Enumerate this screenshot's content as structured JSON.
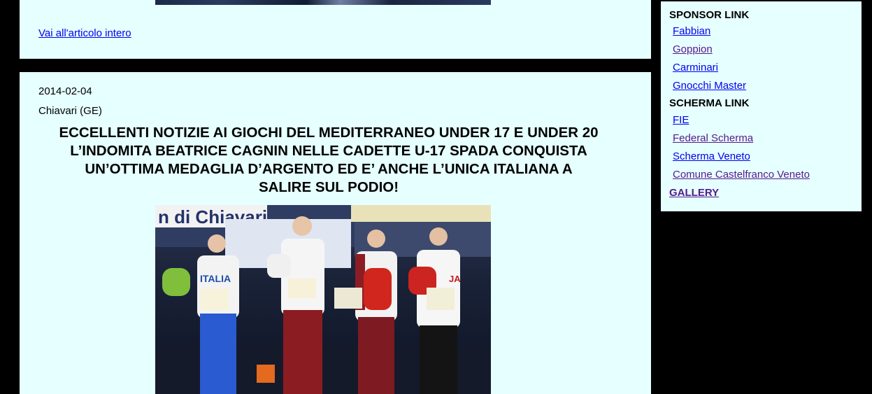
{
  "top_article": {
    "read_more": "Vai all'articolo intero"
  },
  "article": {
    "date": "2014-02-04",
    "place": "Chiavari (GE)",
    "headline_lines": [
      "ECCELLENTI NOTIZIE AI GIOCHI DEL MEDITERRANEO UNDER 17 E UNDER 20",
      "L’INDOMITA BEATRICE CAGNIN NELLE CADETTE U-17 SPADA CONQUISTA",
      "UN’OTTIMA MEDAGLIA D’ARGENTO ED E’ ANCHE L’UNICA ITALIANA A",
      "SALIRE SUL PODIO!"
    ],
    "photo": {
      "banner_text": "n di Chiavari",
      "jacket_text_1": "ITALIA",
      "jacket_text_2": "JA"
    }
  },
  "sidebar": {
    "sponsor_heading": "SPONSOR LINK",
    "sponsor_links": [
      "Fabbian",
      "Goppion",
      "Carminari",
      "Gnocchi Master"
    ],
    "scherma_heading": "SCHERMA LINK",
    "scherma_links": [
      "FIE",
      "Federal Scherma",
      "Scherma Veneto",
      "Comune Castelfranco Veneto"
    ],
    "gallery": "GALLERY"
  },
  "colors": {
    "panel_bg": "#e6ffff",
    "page_bg": "#000000",
    "link": "#0000ee",
    "visited_link": "#551a8b"
  }
}
